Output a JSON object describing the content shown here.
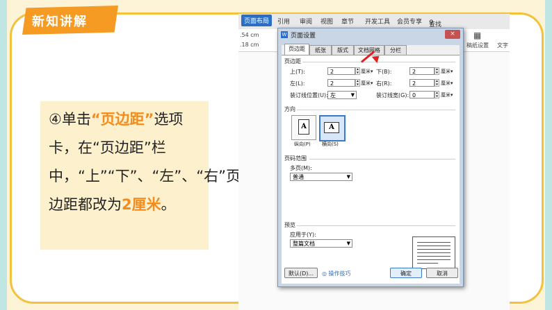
{
  "slide": {
    "section_tag": "新知讲解",
    "instruction_parts": [
      "④单击",
      "“页边距”",
      "选项卡，在“页边距”栏中，“上”“下”、“左”、“右”页边距都改为",
      "2厘米",
      "。"
    ]
  },
  "ribbon": {
    "tabs": [
      "页面布局",
      "引用",
      "审阅",
      "视图",
      "章节",
      "开发工具",
      "会员专享"
    ],
    "search_placeholder": "查找命令、搜索模板",
    "ruler_values": [
      ".54 cm",
      ".18 cm"
    ],
    "right_items": [
      "稿纸设置",
      "文字"
    ]
  },
  "dialog": {
    "title": "页面设置",
    "close": "×",
    "tabs": [
      "页边距",
      "纸张",
      "版式",
      "文档网格",
      "分栏"
    ],
    "margins_section": "页边距",
    "top_label": "上(T):",
    "top_value": "2",
    "top_unit": "厘米▾",
    "bottom_label": "下(B):",
    "bottom_value": "2",
    "bottom_unit": "厘米▾",
    "left_label": "左(L):",
    "left_value": "2",
    "left_unit": "厘米▾",
    "right_label": "右(R):",
    "right_value": "2",
    "right_unit": "厘米▾",
    "gutter_pos_label": "装订线位置(U):",
    "gutter_pos_value": "左",
    "gutter_width_label": "装订线宽(G):",
    "gutter_width_value": "0",
    "gutter_width_unit": "厘米▾",
    "orientation_section": "方向",
    "portrait_label": "纵向(P)",
    "landscape_label": "横向(S)",
    "pages_section": "页码范围",
    "multiple_pages_label": "多页(M):",
    "multiple_pages_value": "普通",
    "preview_section": "预览",
    "apply_to_label": "应用于(Y):",
    "apply_to_value": "整篇文档",
    "default_button": "默认(D)...",
    "tips_link": "操作技巧",
    "ok_button": "确定",
    "cancel_button": "取消"
  },
  "colors": {
    "accent_orange": "#f59a23",
    "frame_yellow": "#f3c23c",
    "callout_bg": "#fdf0cc",
    "highlight": "#f28c1e",
    "arrow_red": "#e02020"
  }
}
